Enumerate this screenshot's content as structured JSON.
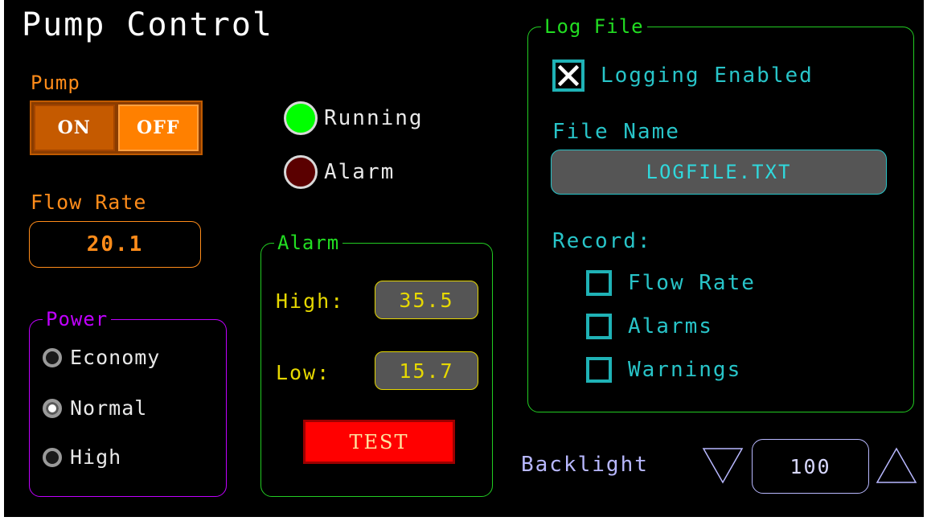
{
  "title": "Pump Control",
  "pump": {
    "label": "Pump",
    "on_label": "ON",
    "off_label": "OFF",
    "state": "OFF"
  },
  "flow": {
    "label": "Flow Rate",
    "value": "20.1"
  },
  "indicators": [
    {
      "label": "Running",
      "color": "#00ff00",
      "lit": true
    },
    {
      "label": "Alarm",
      "color": "#5a0000",
      "lit": false
    }
  ],
  "power": {
    "legend": "Power",
    "options": [
      {
        "label": "Economy",
        "selected": false
      },
      {
        "label": "Normal",
        "selected": true
      },
      {
        "label": "High",
        "selected": false
      }
    ]
  },
  "alarm": {
    "legend": "Alarm",
    "high_label": "High:",
    "high_value": "35.5",
    "low_label": "Low:",
    "low_value": "15.7",
    "test_label": "TEST"
  },
  "log": {
    "legend": "Log File",
    "logging_label": "Logging Enabled",
    "logging_checked": true,
    "file_name_label": "File Name",
    "file_name_value": "LOGFILE.TXT",
    "record_label": "Record:",
    "record_items": [
      {
        "label": "Flow Rate",
        "checked": false
      },
      {
        "label": "Alarms",
        "checked": false
      },
      {
        "label": "Warnings",
        "checked": false
      }
    ]
  },
  "backlight": {
    "label": "Backlight",
    "value": "100"
  },
  "colors": {
    "background": "#000000",
    "pump_orange": "#ff8c1a",
    "power_purple": "#c000ff",
    "group_green": "#22cc22",
    "alarm_yellow": "#e6d800",
    "log_cyan": "#28c4c8",
    "backlight_lavender": "#b8b8ff",
    "test_red": "#ff0000"
  }
}
